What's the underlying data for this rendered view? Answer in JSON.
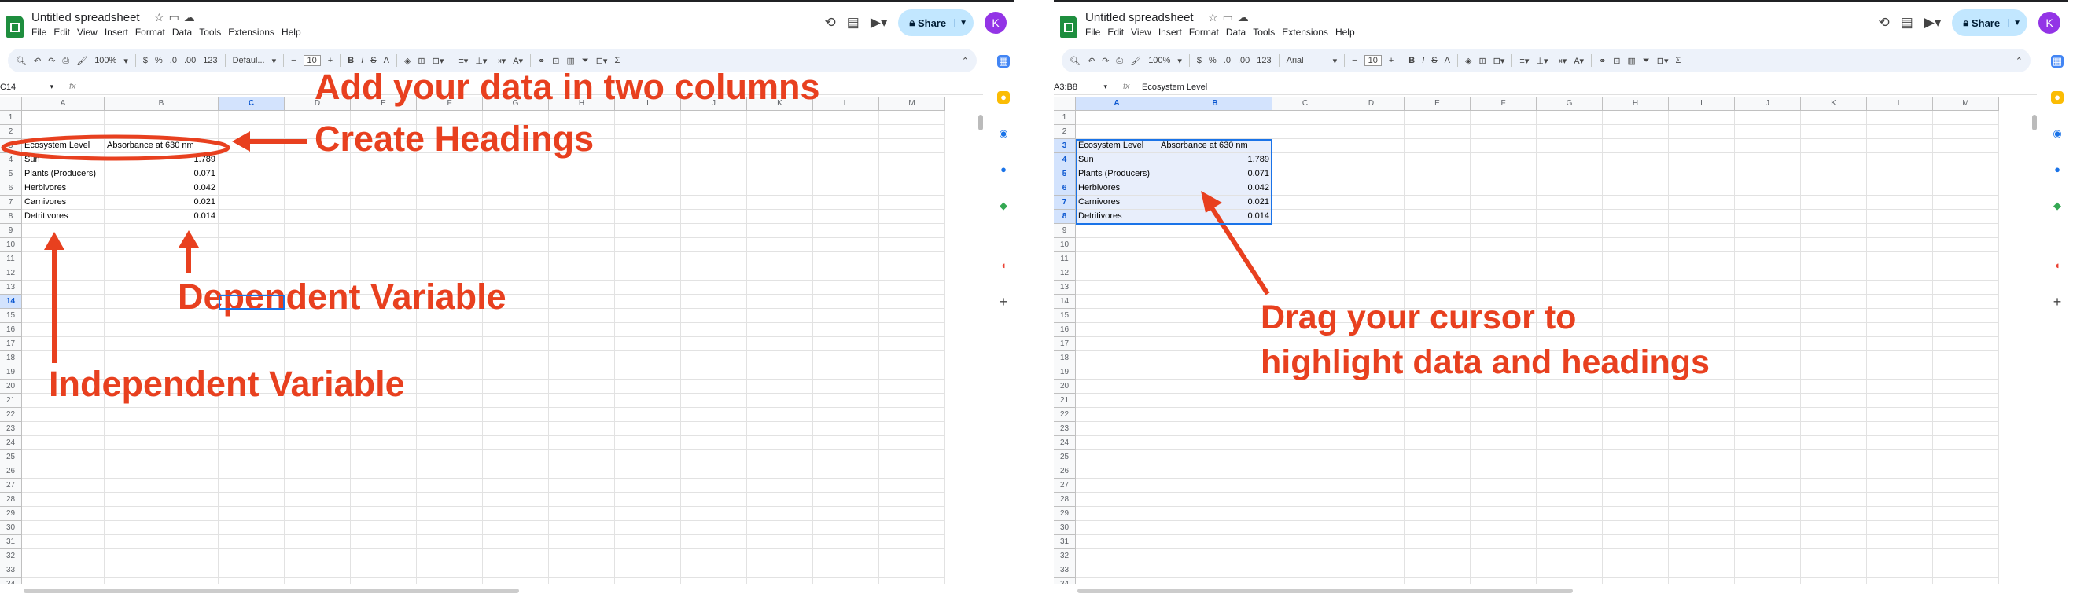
{
  "shared": {
    "title": "Untitled spreadsheet",
    "menu": [
      "File",
      "Edit",
      "View",
      "Insert",
      "Format",
      "Data",
      "Tools",
      "Extensions",
      "Help"
    ],
    "share_label": "Share",
    "avatar_letter": "K",
    "zoom": "100%",
    "font_size": "10",
    "columns": [
      "A",
      "B",
      "C",
      "D",
      "E",
      "F",
      "G",
      "H",
      "I",
      "J",
      "K",
      "L",
      "M"
    ],
    "row_count": 34,
    "table": [
      {
        "row": 3,
        "a": "Ecosystem Level",
        "b": "Absorbance at 630 nm"
      },
      {
        "row": 4,
        "a": "Sun",
        "b": "1.789"
      },
      {
        "row": 5,
        "a": "Plants (Producers)",
        "b": "0.071"
      },
      {
        "row": 6,
        "a": "Herbivores",
        "b": "0.042"
      },
      {
        "row": 7,
        "a": "Carnivores",
        "b": "0.021"
      },
      {
        "row": 8,
        "a": "Detritivores",
        "b": "0.014"
      }
    ],
    "colors": {
      "accent": "#1a73e8",
      "annotation": "#e8401f",
      "share_bg": "#c2e7ff",
      "avatar": "#9334e6"
    }
  },
  "w1": {
    "font_name": "Defaul...",
    "name_box": "C14",
    "formula_value": "",
    "annotations": {
      "add_data": "Add your data in two columns",
      "headings": "Create Headings",
      "dependent": "Dependent Variable",
      "independent": "Independent Variable"
    }
  },
  "w2": {
    "font_name": "Arial",
    "name_box": "A3:B8",
    "formula_value": "Ecosystem Level",
    "annotations": {
      "drag_line1": "Drag your cursor to",
      "drag_line2": "highlight data and headings"
    }
  }
}
